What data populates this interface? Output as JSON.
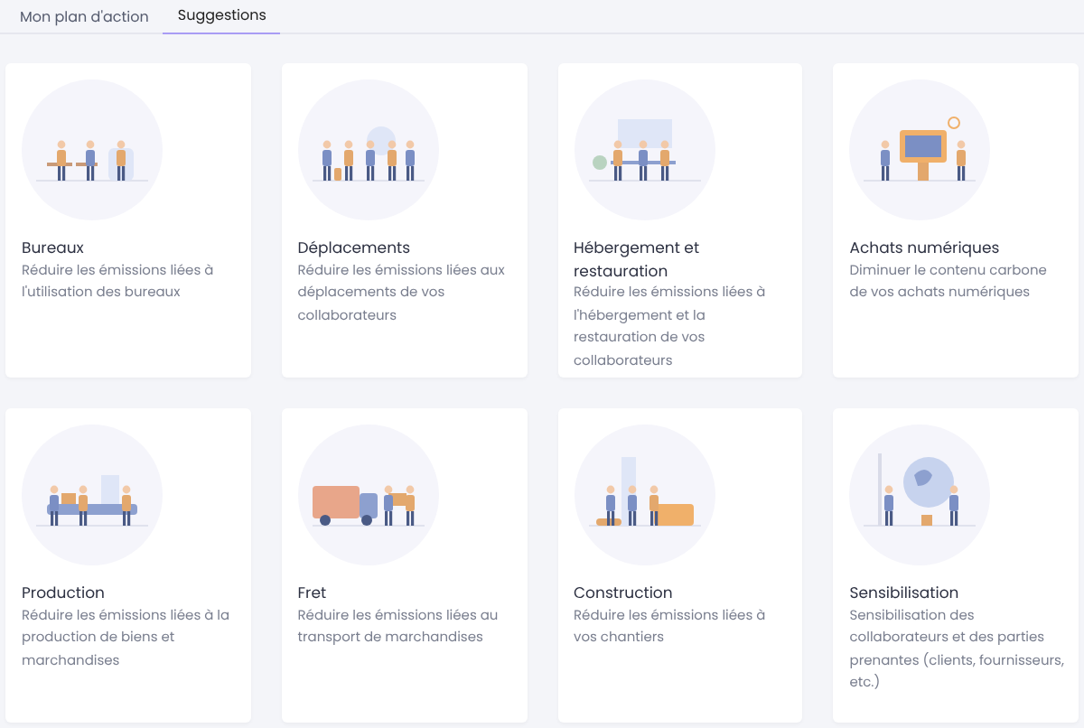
{
  "tabs": [
    {
      "label": "Mon plan d'action",
      "selected": false
    },
    {
      "label": "Suggestions",
      "selected": true
    }
  ],
  "cards": [
    {
      "title": "Bureaux",
      "description": "Réduire les émissions liées à l'utilisation des bureaux"
    },
    {
      "title": "Déplacements",
      "description": "Réduire les émissions liées aux déplacements de vos collaborateurs"
    },
    {
      "title": "Hébergement et restauration",
      "description": "Réduire les émissions liées à l'hébergement et la restauration de vos collaborateurs"
    },
    {
      "title": "Achats numériques",
      "description": "Diminuer le contenu carbone de vos achats numériques"
    },
    {
      "title": "Production",
      "description": "Réduire les émissions liées à la production de biens et marchandises"
    },
    {
      "title": "Fret",
      "description": "Réduire les émissions liées au transport de marchandises"
    },
    {
      "title": "Construction",
      "description": "Réduire les émissions liées à vos chantiers"
    },
    {
      "title": "Sensibilisation",
      "description": "Sensibilisation des collaborateurs et des parties prenantes (clients, fournisseurs, etc.)"
    }
  ]
}
